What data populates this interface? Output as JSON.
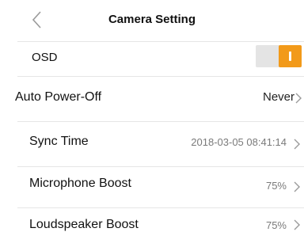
{
  "header": {
    "title": "Camera Setting"
  },
  "settings": {
    "osd": {
      "label": "OSD",
      "enabled": true,
      "accent_color": "#f29a1a"
    },
    "auto_power_off": {
      "label": "Auto Power-Off",
      "value": "Never"
    },
    "sync_time": {
      "label": "Sync Time",
      "value": "2018-03-05 08:41:14"
    },
    "microphone_boost": {
      "label": "Microphone Boost",
      "value": "75%"
    },
    "loudspeaker_boost": {
      "label": "Loudspeaker Boost",
      "value": "75%"
    }
  }
}
